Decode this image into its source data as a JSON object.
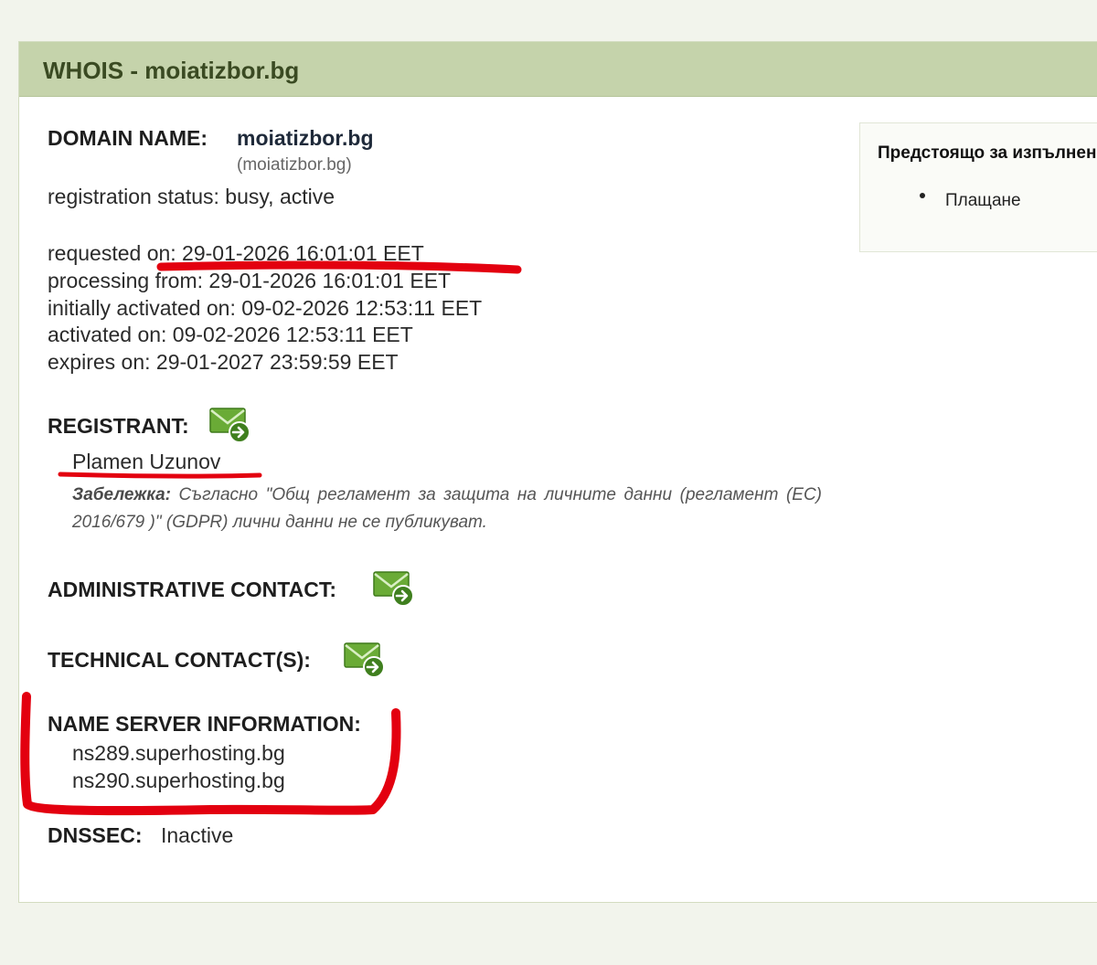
{
  "panel": {
    "title": "WHOIS - moiatizbor.bg"
  },
  "domain": {
    "label": "DOMAIN NAME:",
    "name": "moiatizbor.bg",
    "idn": "(moiatizbor.bg)",
    "status": "registration status: busy, active"
  },
  "dates": {
    "requested": "requested on: 29-01-2026 16:01:01 EET",
    "processing": "processing from: 29-01-2026 16:01:01 EET",
    "initially_activated": "initially activated on: 09-02-2026 12:53:11 EET",
    "activated": "activated on: 09-02-2026 12:53:11 EET",
    "expires": "expires on: 29-01-2027 23:59:59 EET"
  },
  "registrant": {
    "label": "REGISTRANT:",
    "name": "Plamen Uzunov",
    "note_label": "Забележка:",
    "note_text": "Съгласно \"Общ регламент за защита на личните данни (регламент (ЕС) 2016/679 )\" (GDPR) лични данни не се публикуват."
  },
  "admin": {
    "label": "ADMINISTRATIVE CONTACT:"
  },
  "tech": {
    "label": "TECHNICAL CONTACT(S):"
  },
  "nameservers": {
    "label": "NAME SERVER INFORMATION:",
    "items": [
      "ns289.superhosting.bg",
      "ns290.superhosting.bg"
    ]
  },
  "dnssec": {
    "label": "DNSSEC:",
    "value": "Inactive"
  },
  "sidebar": {
    "title": "Предстоящо за изпълнение",
    "items": [
      "Плащане"
    ]
  },
  "icons": {
    "mail_forward": "mail-forward-icon",
    "list_bullet": "bullet-icon"
  },
  "colors": {
    "header_bg": "#c5d3ab",
    "header_text": "#3a4a22",
    "annotation_red": "#e3000f",
    "icon_green": "#5a9a2e"
  }
}
